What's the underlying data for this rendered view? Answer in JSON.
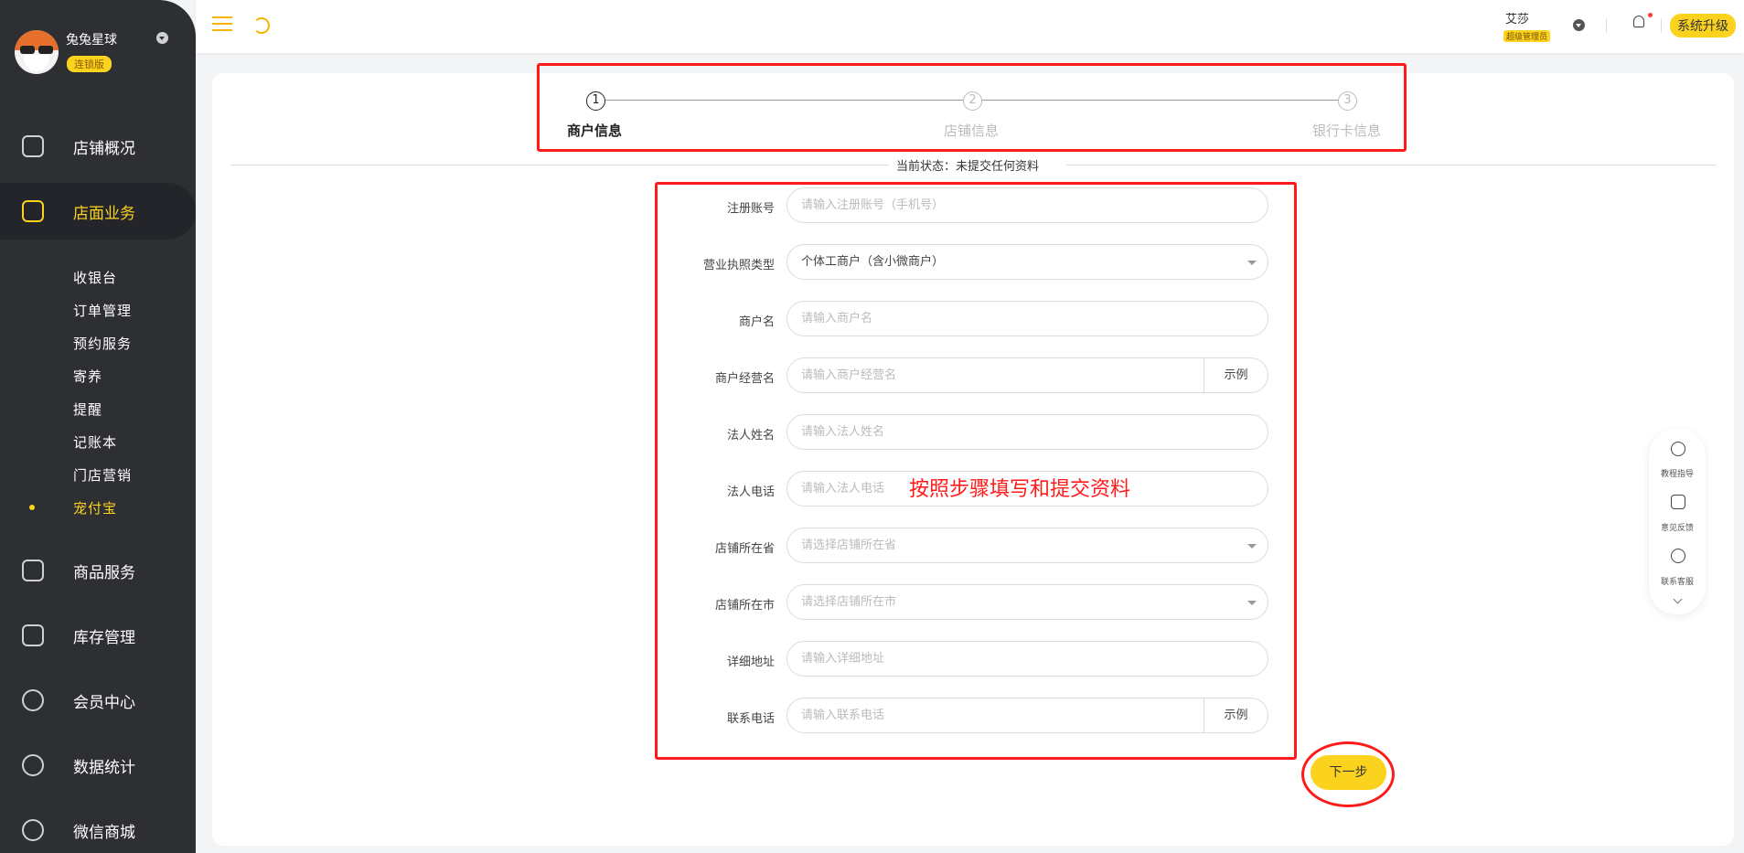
{
  "sidebar": {
    "user_name": "兔兔星球",
    "edition_badge": "连锁版",
    "nav": [
      {
        "label": "店铺概况",
        "icon": "monitor-icon"
      },
      {
        "label": "店面业务",
        "icon": "home-icon"
      },
      {
        "label": "商品服务",
        "icon": "bag-icon"
      },
      {
        "label": "库存管理",
        "icon": "box-icon"
      },
      {
        "label": "会员中心",
        "icon": "member-icon"
      },
      {
        "label": "数据统计",
        "icon": "chart-icon"
      },
      {
        "label": "微信商城",
        "icon": "chat-icon"
      }
    ],
    "sub_items": [
      "收银台",
      "订单管理",
      "预约服务",
      "寄养",
      "提醒",
      "记账本",
      "门店营销",
      "宠付宝"
    ],
    "active_nav": "店面业务",
    "active_sub": "宠付宝"
  },
  "topbar": {
    "user_name": "艾莎",
    "role_badge": "超级管理员",
    "upgrade_label": "系统升级"
  },
  "steps": [
    {
      "num": "1",
      "label": "商户信息",
      "active": true
    },
    {
      "num": "2",
      "label": "店铺信息",
      "active": false
    },
    {
      "num": "3",
      "label": "银行卡信息",
      "active": false
    }
  ],
  "status_text": "当前状态：未提交任何资料",
  "form": {
    "fields": [
      {
        "label": "注册账号",
        "placeholder": "请输入注册账号（手机号）"
      },
      {
        "label": "营业执照类型",
        "value": "个体工商户（含小微商户）"
      },
      {
        "label": "商户名",
        "placeholder": "请输入商户名"
      },
      {
        "label": "商户经营名",
        "placeholder": "请输入商户经营名",
        "example": "示例"
      },
      {
        "label": "法人姓名",
        "placeholder": "请输入法人姓名"
      },
      {
        "label": "法人电话",
        "placeholder": "请输入法人电话"
      },
      {
        "label": "店铺所在省",
        "placeholder": "请选择店铺所在省"
      },
      {
        "label": "店铺所在市",
        "placeholder": "请选择店铺所在市"
      },
      {
        "label": "详细地址",
        "placeholder": "请输入详细地址"
      },
      {
        "label": "联系电话",
        "placeholder": "请输入联系电话",
        "example": "示例"
      }
    ],
    "next_label": "下一步"
  },
  "annotation_text": "按照步骤填写和提交资料",
  "float_panel": {
    "items": [
      "教程指导",
      "意见反馈",
      "联系客服"
    ]
  },
  "colors": {
    "accent": "#fbd31f",
    "sidebar_bg": "#2d2f33",
    "annotation": "#ff1a1a"
  }
}
